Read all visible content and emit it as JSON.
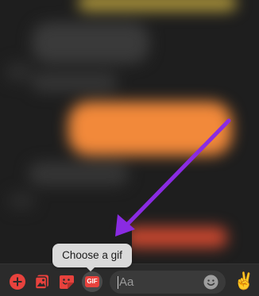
{
  "tooltip": {
    "text": "Choose a gif"
  },
  "composer": {
    "input_placeholder": "Aa",
    "gif_label": "GIF",
    "like_emoji": "✌️",
    "icons": {
      "plus": "plus-circle-icon",
      "photo": "photo-icon",
      "sticker": "sticker-icon",
      "gif": "gif-icon",
      "emoji": "emoji-icon"
    }
  },
  "colors": {
    "accent": "#e8423d",
    "annotation_arrow": "#8a2be2",
    "tooltip_bg": "#dadada",
    "composer_bg": "#2b2b2b",
    "input_bg": "#3a3a3a"
  }
}
